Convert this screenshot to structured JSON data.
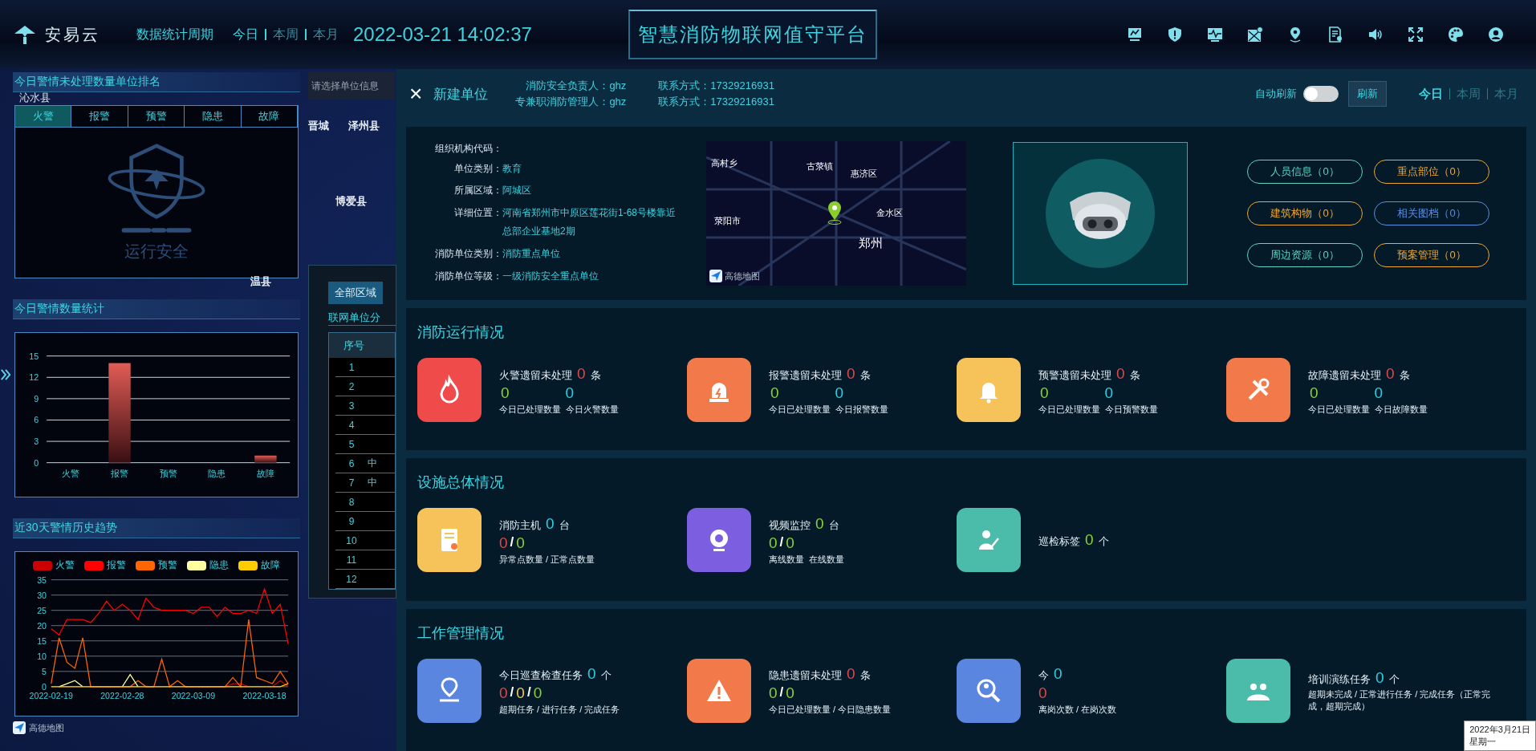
{
  "header": {
    "logo_text": "安易云",
    "period_label": "数据统计周期",
    "period_tabs": [
      {
        "label": "今日",
        "selected": true
      },
      {
        "label": "本周",
        "selected": false
      },
      {
        "label": "本月",
        "selected": false
      }
    ],
    "datetime": "2022-03-21 14:02:37",
    "title": "智慧消防物联网值守平台"
  },
  "map_labels": [
    "晋城",
    "泽州县",
    "博爱县",
    "温县"
  ],
  "left": {
    "ranking": {
      "title": "今日警情未处理数量单位排名",
      "region": "沁水县",
      "tabs": [
        {
          "label": "火警",
          "selected": true
        },
        {
          "label": "报警",
          "selected": false
        },
        {
          "label": "预警",
          "selected": false
        },
        {
          "label": "隐患",
          "selected": false
        },
        {
          "label": "故障",
          "selected": false
        }
      ],
      "empty_text": "运行安全"
    },
    "today_stats": {
      "title": "今日警情数量统计",
      "chart_data": {
        "type": "bar",
        "categories": [
          "火警",
          "报警",
          "预警",
          "隐患",
          "故障"
        ],
        "values": [
          0,
          14,
          0,
          0,
          1
        ],
        "ylim": [
          0,
          15
        ],
        "yticks": [
          0,
          3,
          6,
          9,
          12,
          15
        ],
        "grid": true
      }
    },
    "trend": {
      "title": "近30天警情历史趋势",
      "chart_data": {
        "type": "line",
        "grid": true,
        "legend": "top",
        "categories": [
          "2022-02-19",
          null,
          null,
          null,
          null,
          null,
          null,
          null,
          null,
          "2022-02-28",
          null,
          null,
          null,
          null,
          null,
          null,
          null,
          null,
          "2022-03-09",
          null,
          null,
          null,
          null,
          null,
          null,
          null,
          null,
          "2022-03-18",
          null,
          null,
          null
        ],
        "ylim": [
          0,
          35
        ],
        "yticks": [
          0,
          5,
          10,
          15,
          20,
          25,
          30,
          35
        ],
        "series": [
          {
            "name": "火警",
            "color": "#cc0000",
            "values": [
              null,
              null,
              null,
              null,
              null,
              null,
              null,
              null,
              null,
              null,
              null,
              null,
              null,
              null,
              null,
              null,
              null,
              null,
              null,
              null,
              null,
              null,
              0,
              1,
              1,
              0,
              null,
              null,
              0,
              2,
              0
            ]
          },
          {
            "name": "报警",
            "color": "#ff0000",
            "values": [
              19,
              17,
              22,
              22,
              22,
              21,
              24,
              28,
              25,
              27,
              25,
              22,
              29,
              26,
              25,
              25,
              25,
              25,
              24,
              26,
              26,
              23,
              26,
              24,
              24,
              25,
              24,
              32,
              24,
              27,
              14
            ]
          },
          {
            "name": "预警",
            "color": "#ff6600",
            "values": [
              1,
              16,
              8,
              6,
              16,
              0,
              0,
              0,
              0,
              0,
              0,
              2,
              0,
              0,
              9,
              0,
              2,
              0,
              0,
              0,
              0,
              0,
              0,
              3,
              0,
              22,
              3,
              2,
              1,
              5,
              1
            ]
          },
          {
            "name": "隐患",
            "color": "#ffffa0",
            "values": [
              null,
              0,
              1,
              2,
              0,
              null,
              null,
              null,
              null,
              0,
              4,
              0,
              null,
              null,
              null,
              null,
              null,
              null,
              null,
              null,
              null,
              null,
              null,
              null,
              null,
              null,
              null,
              null,
              null,
              null,
              null
            ]
          },
          {
            "name": "故障",
            "color": "#ffcc00",
            "values": [
              0,
              0,
              0,
              0,
              0,
              0,
              0,
              0,
              0,
              0,
              0,
              0,
              0,
              0,
              0,
              0,
              0,
              0,
              0,
              0,
              0,
              0,
              0,
              0,
              0,
              0,
              0,
              0,
              0,
              0,
              1
            ]
          }
        ]
      }
    },
    "map_attribution": "高德地图"
  },
  "middle": {
    "search": {
      "placeholder": "请选择单位信息"
    },
    "region_button": "全部区域",
    "list_title": "联网单位分",
    "table": {
      "columns": [
        "序号"
      ],
      "rows": [
        {
          "no": "1"
        },
        {
          "no": "2"
        },
        {
          "no": "3"
        },
        {
          "no": "4"
        },
        {
          "no": "5"
        },
        {
          "no": "6",
          "column_2": "中"
        },
        {
          "no": "7",
          "column_2": "中"
        },
        {
          "no": "8"
        },
        {
          "no": "9"
        },
        {
          "no": "10"
        },
        {
          "no": "11"
        },
        {
          "no": "12"
        }
      ]
    }
  },
  "unit_panel": {
    "close": "×",
    "title": "新建单位",
    "contacts": [
      {
        "label": "消防安全负责人：",
        "value": "ghz"
      },
      {
        "label": "联系方式：",
        "value": "17329216931"
      },
      {
        "label": "专兼职消防管理人：",
        "value": "ghz"
      },
      {
        "label": "联系方式：",
        "value": "17329216931"
      }
    ],
    "auto_refresh": {
      "label": "自动刷新",
      "on": false
    },
    "refresh_button": "刷新",
    "period_tabs": [
      {
        "label": "今日",
        "selected": true
      },
      {
        "label": "本周",
        "selected": false
      },
      {
        "label": "本月",
        "selected": false
      }
    ],
    "info": {
      "fields": [
        {
          "label": "组织机构代码："
        },
        {
          "label": "单位类别：",
          "value": "教育"
        },
        {
          "label": "所属区域：",
          "value": "阿城区"
        },
        {
          "label": "详细位置：",
          "value": "河南省郑州市中原区莲花街1-68号楼靠近总部企业基地2期"
        },
        {
          "label": "消防单位类别：",
          "value": "消防重点单位"
        },
        {
          "label": "消防单位等级：",
          "value": "一级消防安全重点单位"
        }
      ],
      "map_labels": [
        "高村乡",
        "古荥镇",
        "惠济区",
        "荥阳市",
        "金水区",
        "郑州"
      ],
      "map_attribution": "高德地图",
      "buttons": [
        {
          "label": "人员信息（0）",
          "color": "#5fd3c8"
        },
        {
          "label": "重点部位（0）",
          "color": "#f0a830"
        },
        {
          "label": "建筑构物（0）",
          "color": "#f0a830"
        },
        {
          "label": "相关图档（0）",
          "color": "#5b8fe0"
        },
        {
          "label": "周边资源（0）",
          "color": "#5fd3c8"
        },
        {
          "label": "预案管理（0）",
          "color": "#f0a830"
        }
      ]
    },
    "sections": [
      {
        "title": "消防运行情况",
        "items": [
          {
            "color": "#ef4b4b",
            "label": "火警遗留未处理",
            "count": {
              "text": "0",
              "color": "#e04848"
            },
            "unit": "条",
            "values": [
              {
                "text": "0",
                "color": "#8bd13a"
              },
              {
                "text": "0",
                "color": "#2ad1e0"
              }
            ],
            "captions": [
              "今日已处理数量",
              "今日火警数量"
            ]
          },
          {
            "color": "#f2794a",
            "label": "报警遗留未处理",
            "count": {
              "text": "0",
              "color": "#e04848"
            },
            "unit": "条",
            "values": [
              {
                "text": "0",
                "color": "#8bd13a"
              },
              {
                "text": "0",
                "color": "#2ad1e0"
              }
            ],
            "captions": [
              "今日已处理数量",
              "今日报警数量"
            ]
          },
          {
            "color": "#f6c35b",
            "label": "预警遗留未处理",
            "count": {
              "text": "0",
              "color": "#e04848"
            },
            "unit": "条",
            "values": [
              {
                "text": "0",
                "color": "#8bd13a"
              },
              {
                "text": "0",
                "color": "#2ad1e0"
              }
            ],
            "captions": [
              "今日已处理数量",
              "今日预警数量"
            ]
          },
          {
            "color": "#f2794a",
            "label": "故障遗留未处理",
            "count": {
              "text": "0",
              "color": "#e04848"
            },
            "unit": "条",
            "values": [
              {
                "text": "0",
                "color": "#8bd13a"
              },
              {
                "text": "0",
                "color": "#2ad1e0"
              }
            ],
            "captions": [
              "今日已处理数量",
              "今日故障数量"
            ]
          }
        ]
      },
      {
        "title": "设施总体情况",
        "items": [
          {
            "color": "#f6c35b",
            "label": "消防主机",
            "count": {
              "text": "0",
              "color": "#2ad1e0"
            },
            "unit": "台",
            "values": [
              {
                "text": "0",
                "color": "#e04848"
              },
              {
                "text": "/",
                "color": "#ffffff"
              },
              {
                "text": "0",
                "color": "#8bd13a"
              }
            ],
            "captions": [
              "异常点数量 / 正常点数量"
            ]
          },
          {
            "color": "#7b5fe0",
            "label": "视频监控",
            "count": {
              "text": "0",
              "color": "#8bd13a"
            },
            "unit": "台",
            "values": [
              {
                "text": "0",
                "color": "#8bd13a"
              },
              {
                "text": "/",
                "color": "#ffffff"
              },
              {
                "text": "0",
                "color": "#8bd13a"
              }
            ],
            "captions": [
              "离线数量",
              "在线数量"
            ]
          },
          {
            "color": "#4bbcaa",
            "label": "巡检标签",
            "count": {
              "text": "0",
              "color": "#8bd13a"
            },
            "unit": "个"
          }
        ]
      },
      {
        "title": "工作管理情况",
        "items": [
          {
            "color": "#5b86e0",
            "label": "今日巡查检查任务",
            "count": {
              "text": "0",
              "color": "#2ad1e0"
            },
            "unit": "个",
            "values": [
              {
                "text": "0",
                "color": "#e04848"
              },
              {
                "text": "/",
                "color": "#ffffff"
              },
              {
                "text": "0",
                "color": "#f6c35b"
              },
              {
                "text": "/",
                "color": "#ffffff"
              },
              {
                "text": "0",
                "color": "#8bd13a"
              }
            ],
            "captions": [
              "超期任务 / 进行任务 / 完成任务"
            ]
          },
          {
            "color": "#f2794a",
            "label": "隐患遗留未处理",
            "count": {
              "text": "0",
              "color": "#e04848"
            },
            "unit": "条",
            "values": [
              {
                "text": "0",
                "color": "#8bd13a"
              },
              {
                "text": "/",
                "color": "#ffffff"
              },
              {
                "text": "0",
                "color": "#8bd13a"
              }
            ],
            "captions": [
              "今日已处理数量 / 今日隐患数量"
            ]
          },
          {
            "color": "#5b86e0",
            "label": "今",
            "count": {
              "text": "0",
              "color": "#2ad1e0"
            },
            "values": [
              {
                "text": "0",
                "color": "#e04848"
              }
            ],
            "captions": [
              "离岗次数 / 在岗次数"
            ]
          },
          {
            "color": "#4bbcaa",
            "label": "培训演练任务",
            "count": {
              "text": "0",
              "color": "#2ad1e0"
            },
            "unit": "个",
            "captions": [
              "超期未完成 / 正常进行任务 / 完成任务（正常完成，超期完成）"
            ]
          }
        ]
      }
    ]
  },
  "clock_tooltip": [
    "2022年3月21日",
    "星期一"
  ]
}
